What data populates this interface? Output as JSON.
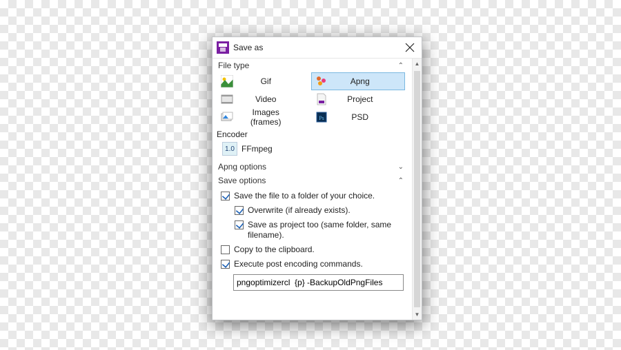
{
  "title": "Save as",
  "sections": {
    "fileType": "File type",
    "encoder": "Encoder",
    "apngOptions": "Apng options",
    "saveOptions": "Save options"
  },
  "fileTypes": {
    "gif": {
      "label": "Gif"
    },
    "apng": {
      "label": "Apng",
      "selected": true
    },
    "video": {
      "label": "Video"
    },
    "project": {
      "label": "Project"
    },
    "frames": {
      "label": "Images (frames)"
    },
    "psd": {
      "label": "PSD"
    }
  },
  "encoder": {
    "badge": "1.0",
    "name": "FFmpeg"
  },
  "saveOptions": {
    "saveToFolder": {
      "label": "Save the file to a folder of your choice.",
      "checked": true
    },
    "overwrite": {
      "label": "Overwrite (if already exists).",
      "checked": true
    },
    "saveProject": {
      "label": "Save as project too (same folder, same filename).",
      "checked": true
    },
    "copyClipboard": {
      "label": "Copy to the clipboard.",
      "checked": false
    },
    "postCmd": {
      "label": "Execute post encoding commands.",
      "checked": true
    },
    "postCmdValue": "pngoptimizercl  {p} -BackupOldPngFiles"
  }
}
